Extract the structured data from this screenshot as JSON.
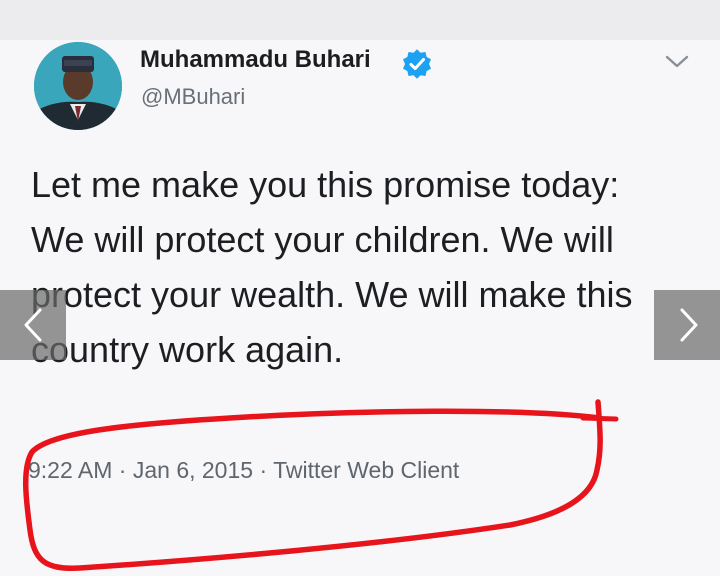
{
  "tweet": {
    "author_name": "Muhammadu Buhari",
    "author_handle": "@MBuhari",
    "verified": true,
    "text": "Let me make you this promise today: We will protect your children. We will protect your wealth. We will make this country work again.",
    "time": "9:22 AM",
    "date": "Jan 6, 2015",
    "source": "Twitter Web Client",
    "separator": "·"
  },
  "icons": {
    "verified": "verified-badge-icon",
    "menu": "chevron-down-icon",
    "prev": "chevron-left-icon",
    "next": "chevron-right-icon"
  },
  "colors": {
    "verified_blue": "#1da1f2",
    "annotation_red": "#e8141c",
    "text": "#1c1e21",
    "muted": "#5f666d"
  }
}
